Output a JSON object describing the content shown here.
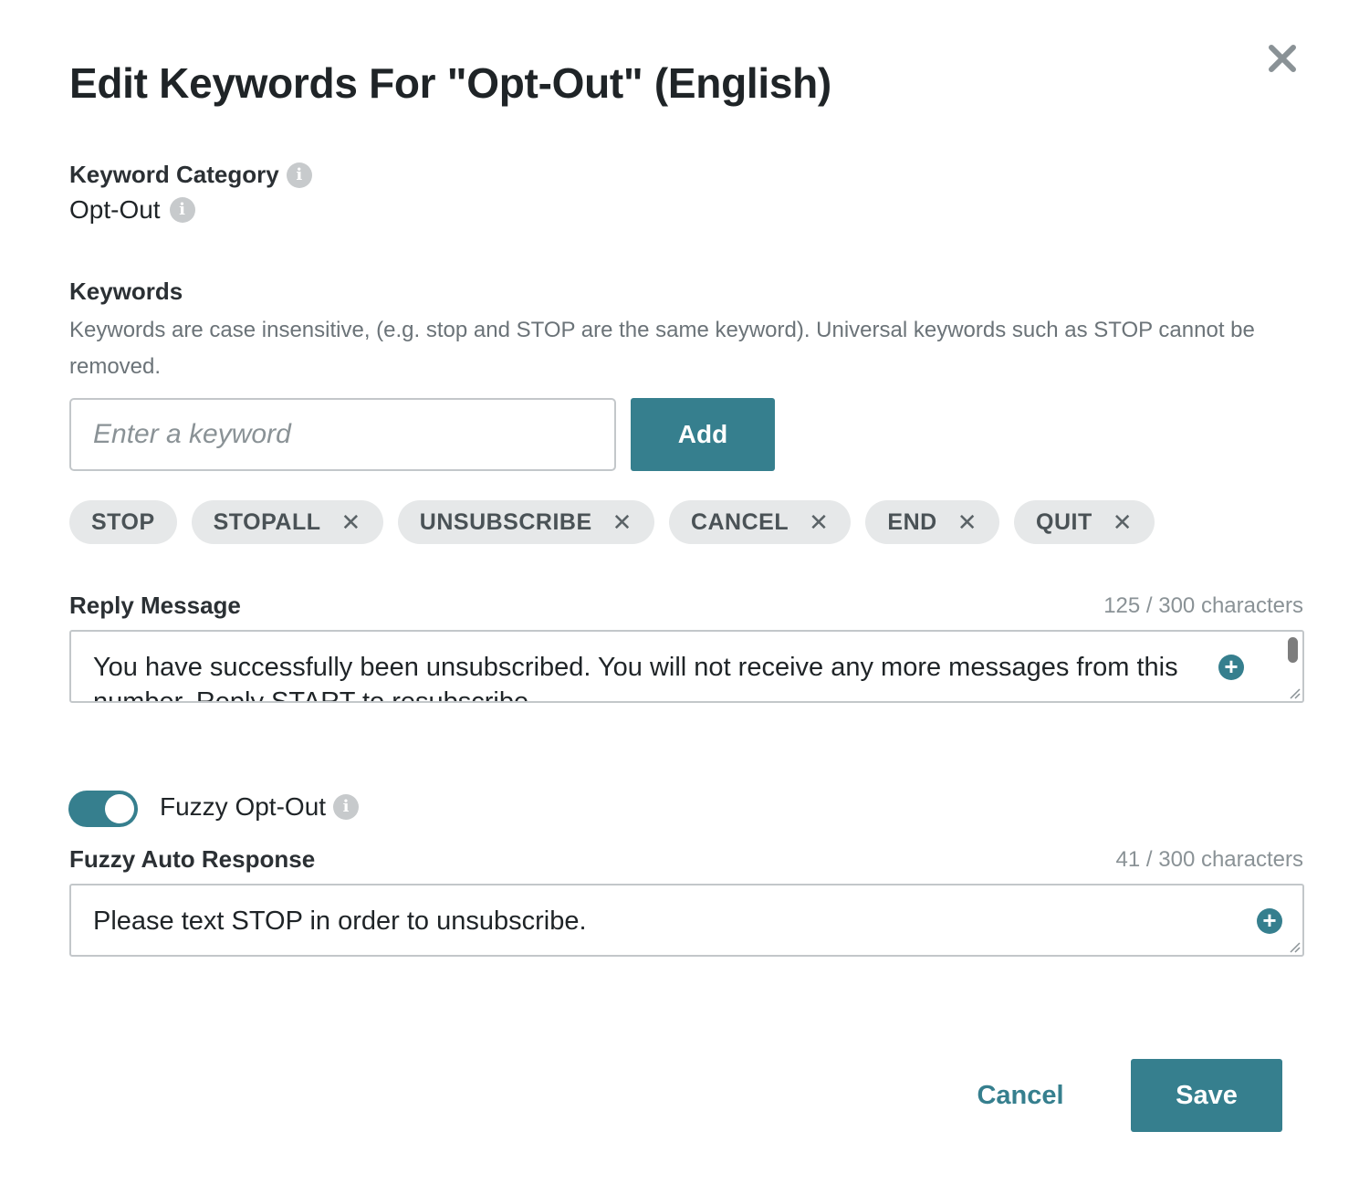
{
  "dialog": {
    "title": "Edit Keywords For \"Opt-Out\" (English)"
  },
  "keyword_category": {
    "label": "Keyword Category",
    "value": "Opt-Out"
  },
  "keywords": {
    "label": "Keywords",
    "description": "Keywords are case insensitive, (e.g. stop and STOP are the same keyword). Universal keywords such as STOP cannot be removed.",
    "input_placeholder": "Enter a keyword",
    "add_label": "Add",
    "chips": [
      {
        "label": "STOP",
        "removable": false
      },
      {
        "label": "STOPALL",
        "removable": true
      },
      {
        "label": "UNSUBSCRIBE",
        "removable": true
      },
      {
        "label": "CANCEL",
        "removable": true
      },
      {
        "label": "END",
        "removable": true
      },
      {
        "label": "QUIT",
        "removable": true
      }
    ]
  },
  "reply_message": {
    "label": "Reply Message",
    "count": "125 / 300 characters",
    "text": "You have successfully been unsubscribed. You will not receive any more messages from this number. Reply START to resubscribe."
  },
  "fuzzy_opt_out": {
    "label": "Fuzzy Opt-Out",
    "enabled": true
  },
  "fuzzy_auto_response": {
    "label": "Fuzzy Auto Response",
    "count": "41 / 300 characters",
    "text": "Please text STOP in order to unsubscribe."
  },
  "footer": {
    "cancel_label": "Cancel",
    "save_label": "Save"
  },
  "colors": {
    "accent": "#367f8e",
    "chip_bg": "#e6e8e9",
    "info_icon": "#c7cacc"
  },
  "icons": {
    "close": "close-icon",
    "info": "info-icon",
    "chip_remove": "close-icon",
    "insert": "plus-circle-icon"
  }
}
